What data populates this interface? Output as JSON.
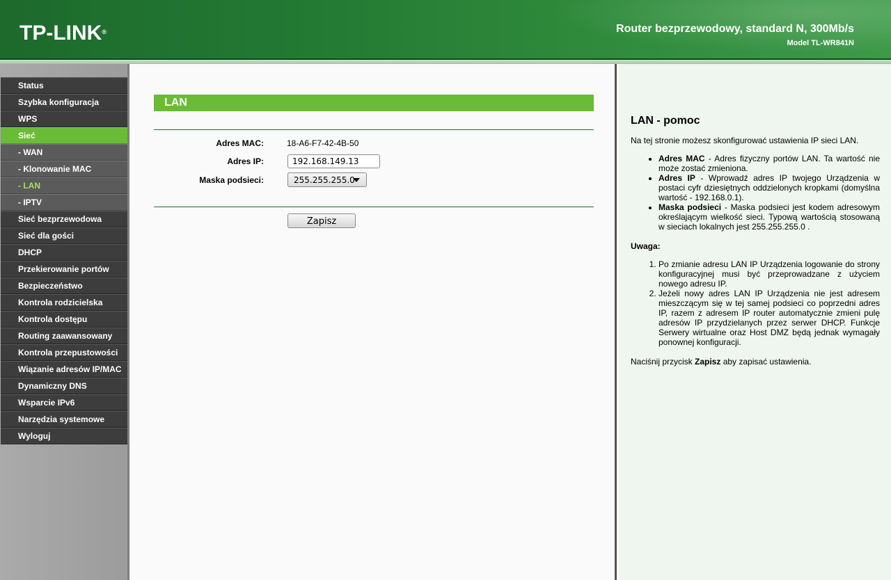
{
  "header": {
    "logo": "TP-LINK",
    "logo_mark": "®",
    "title": "Router bezprzewodowy, standard N, 300Mb/s",
    "model": "Model TL-WR841N"
  },
  "sidebar": {
    "items": [
      {
        "label": "Status"
      },
      {
        "label": "Szybka konfiguracja"
      },
      {
        "label": "WPS"
      },
      {
        "label": "Sieć"
      },
      {
        "label": "- WAN"
      },
      {
        "label": "- Klonowanie MAC"
      },
      {
        "label": "- LAN"
      },
      {
        "label": "- IPTV"
      },
      {
        "label": "Sieć bezprzewodowa"
      },
      {
        "label": "Sieć dla gości"
      },
      {
        "label": "DHCP"
      },
      {
        "label": "Przekierowanie portów"
      },
      {
        "label": "Bezpieczeństwo"
      },
      {
        "label": "Kontrola rodzicielska"
      },
      {
        "label": "Kontrola dostępu"
      },
      {
        "label": "Routing zaawansowany"
      },
      {
        "label": "Kontrola przepustowości"
      },
      {
        "label": "Wiązanie adresów IP/MAC"
      },
      {
        "label": "Dynamiczny DNS"
      },
      {
        "label": "Wsparcie IPv6"
      },
      {
        "label": "Narzędzia systemowe"
      },
      {
        "label": "Wyloguj"
      }
    ]
  },
  "main": {
    "section_title": "LAN",
    "mac_label": "Adres MAC:",
    "mac_value": "18-A6-F7-42-4B-50",
    "ip_label": "Adres IP:",
    "ip_value": "192.168.149.13",
    "mask_label": "Maska podsieci:",
    "mask_value": "255.255.255.0",
    "save_label": "Zapisz"
  },
  "help": {
    "title": "LAN - pomoc",
    "intro": "Na tej stronie możesz skonfigurować ustawienia IP sieci LAN.",
    "bullets": [
      {
        "term": "Adres MAC",
        "text": " - Adres fizyczny portów LAN. Ta wartość nie może zostać zmieniona."
      },
      {
        "term": "Adres IP",
        "text": " - Wprowadź adres IP twojego Urządzenia w postaci cyfr dziesiętnych oddzielonych kropkami (domyślna wartość - 192.168.0.1)."
      },
      {
        "term": "Maska podsieci",
        "text": " - Maska podsieci jest kodem adresowym określającym wielkość sieci. Typową wartością stosowaną w sieciach lokalnych jest 255.255.255.0 ."
      }
    ],
    "note_label": "Uwaga:",
    "notes": [
      "Po zmianie adresu LAN IP Urządzenia logowanie do strony konfiguracyjnej musi być przeprowadzane z użyciem nowego adresu IP.",
      "Jeżeli nowy adres LAN IP Urządzenia nie jest adresem mieszczącym się w tej samej podsieci co poprzedni adres IP, razem z adresem IP router automatycznie zmieni pulę adresów IP przydzielanych przez serwer DHCP. Funkcje Serwery wirtualne oraz Host DMZ będą jednak wymagały ponownej konfiguracji."
    ],
    "footer_pre": "Naciśnij przycisk ",
    "footer_bold": "Zapisz",
    "footer_post": " aby zapisać ustawienia."
  }
}
